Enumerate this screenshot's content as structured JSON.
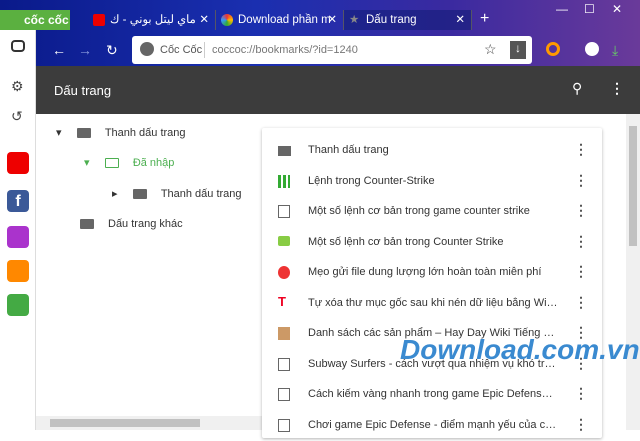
{
  "browser": {
    "logo": "cốc cốc",
    "tabs": [
      {
        "title": "ماي ليتل بوني - ك"
      },
      {
        "title": "Download phần m"
      },
      {
        "title": "Dấu trang",
        "active": true
      }
    ],
    "new_tab": "+",
    "window_controls": [
      "—",
      "☐",
      "✕"
    ],
    "omnibox": {
      "brand": "Cốc Cốc",
      "url": "coccoc://bookmarks/?id=1240"
    }
  },
  "header": {
    "title": "Dấu trang"
  },
  "tree": [
    {
      "label": "Thanh dấu trang",
      "expanded": true
    },
    {
      "label": "Đã nhập",
      "selected": true
    },
    {
      "label": "Thanh dấu trang"
    },
    {
      "label": "Dấu trang khác"
    }
  ],
  "bookmarks": [
    {
      "label": "Thanh dấu trang",
      "icon": "folder-icon"
    },
    {
      "label": "Lệnh trong Counter-Strike",
      "icon": "grid-icon"
    },
    {
      "label": "Một số lệnh cơ bản trong game counter strike",
      "icon": "page-icon"
    },
    {
      "label": "Một số lệnh cơ bản trong Counter Strike",
      "icon": "chat-icon"
    },
    {
      "label": "Mẹo gửi file dung lượng lớn hoàn toàn miễn phí",
      "icon": "red-logo-icon"
    },
    {
      "label": "Tự xóa thư mục gốc sau khi nén dữ liệu bằng WinRAR",
      "icon": "t-logo-icon"
    },
    {
      "label": "Danh sách các sản phẩm – Hay Day Wiki Tiếng Việt",
      "icon": "hayday-icon"
    },
    {
      "label": "Subway Surfers - cách vượt qua nhiệm vụ khó trong game",
      "icon": "page-icon"
    },
    {
      "label": "Cách kiếm vàng nhanh trong game Epic Defense - Elemental",
      "icon": "page-icon"
    },
    {
      "label": "Chơi game Epic Defense - điểm mạnh yếu của các thành",
      "icon": "page-icon"
    }
  ],
  "watermark": "Download.com.vn",
  "colors": {
    "accent_green": "#4caf50",
    "header": "#3c3c3c"
  }
}
